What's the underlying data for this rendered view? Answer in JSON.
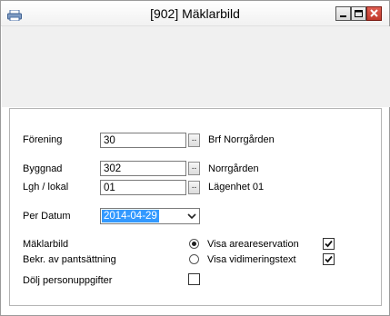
{
  "window": {
    "title": "[902]  Mäklarbild",
    "icons": {
      "app": "printer-icon",
      "minimize": "minimize-icon",
      "maximize": "maximize-icon",
      "close": "close-icon"
    }
  },
  "form": {
    "forening": {
      "label": "Förening",
      "value": "30",
      "name": "Brf Norrgården"
    },
    "byggnad": {
      "label": "Byggnad",
      "value": "302",
      "name": "Norrgården"
    },
    "lgh": {
      "label": "Lgh / lokal",
      "value": "01",
      "name": "Lägenhet 01"
    },
    "lookup_glyph": "..",
    "per_datum": {
      "label": "Per Datum",
      "value": "2014-04-29"
    },
    "radios": [
      {
        "label": "Mäklarbild",
        "option": "Visa areareservation",
        "selected": true,
        "checkbox_checked": true
      },
      {
        "label": "Bekr. av pantsättning",
        "option": "Visa vidimeringstext",
        "selected": false,
        "checkbox_checked": true
      }
    ],
    "dolj": {
      "label": "Dölj personuppgifter",
      "checked": false
    }
  },
  "colors": {
    "selection": "#3399ff",
    "close_button": "#c0392b",
    "toolbar_area": "#f0f0f0"
  }
}
